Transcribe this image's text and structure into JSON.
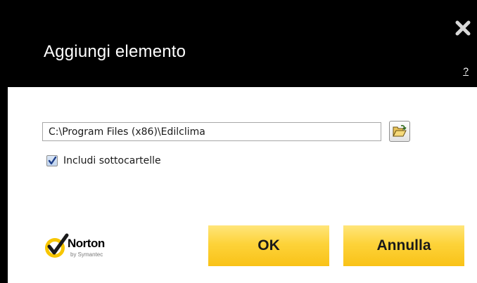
{
  "dialog": {
    "title": "Aggiungi elemento",
    "help_label": "?"
  },
  "form": {
    "path_value": "C:\\Program Files (x86)\\Edilclima",
    "include_subfolders_label": "Includi sottocartelle",
    "include_subfolders_checked": true
  },
  "brand": {
    "name": "Norton",
    "sub": "by Symantec"
  },
  "buttons": {
    "ok_label": "OK",
    "cancel_label": "Annulla"
  },
  "icons": {
    "close": "close-icon",
    "browse": "folder-open-icon",
    "check": "checkmark-icon"
  },
  "colors": {
    "header": "#000000",
    "button_yellow": "#fdd33a",
    "logo_yellow": "#f7c600"
  }
}
